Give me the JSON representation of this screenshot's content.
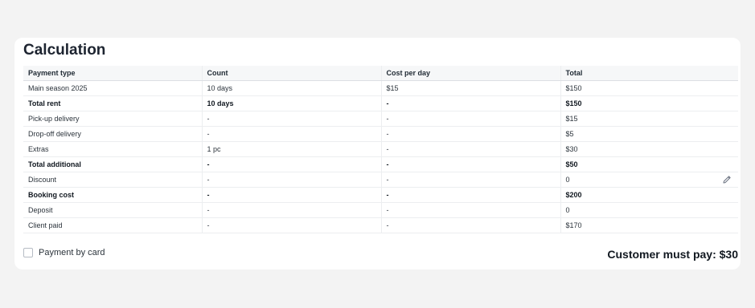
{
  "title": "Calculation",
  "table": {
    "headers": [
      "Payment type",
      "Count",
      "Cost per day",
      "Total"
    ],
    "rows": [
      {
        "cells": [
          "Main season 2025",
          "10 days",
          "$15",
          "$150"
        ],
        "bold": false
      },
      {
        "cells": [
          "Total rent",
          "10 days",
          "-",
          "$150"
        ],
        "bold": true
      },
      {
        "cells": [
          "Pick-up delivery",
          "-",
          "-",
          "$15"
        ],
        "bold": false
      },
      {
        "cells": [
          "Drop-off delivery",
          "-",
          "-",
          "$5"
        ],
        "bold": false
      },
      {
        "cells": [
          "Extras",
          "1 pc",
          "-",
          "$30"
        ],
        "bold": false
      },
      {
        "cells": [
          "Total additional",
          "-",
          "-",
          "$50"
        ],
        "bold": true
      },
      {
        "cells": [
          "Discount",
          "-",
          "-",
          "0"
        ],
        "bold": false,
        "editable": true
      },
      {
        "cells": [
          "Booking cost",
          "-",
          "-",
          "$200"
        ],
        "bold": true
      },
      {
        "cells": [
          "Deposit",
          "-",
          "-",
          "0"
        ],
        "bold": false
      },
      {
        "cells": [
          "Client paid",
          "-",
          "-",
          "$170"
        ],
        "bold": false
      }
    ]
  },
  "payment_by_card": {
    "label": "Payment by card",
    "checked": false
  },
  "customer_must_pay": "Customer must pay: $30",
  "icons": {
    "edit": "pencil-icon"
  }
}
